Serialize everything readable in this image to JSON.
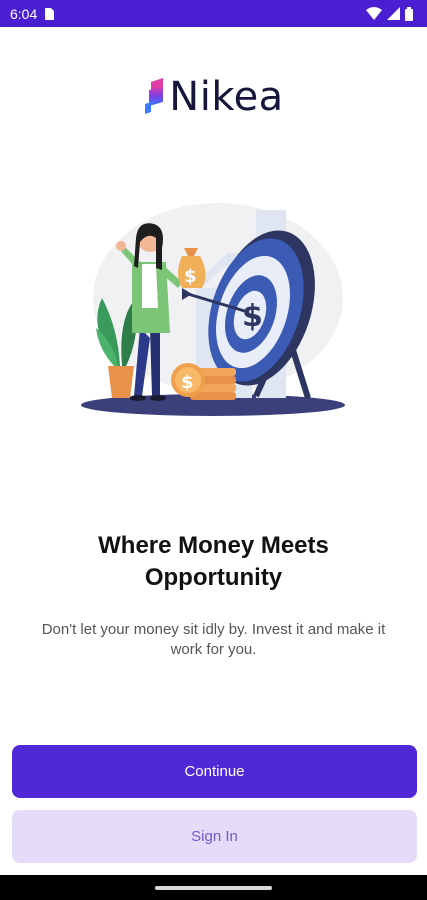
{
  "status_bar": {
    "time": "6:04"
  },
  "brand": {
    "name": "Nikea",
    "accent": "#5128d8"
  },
  "onboarding": {
    "headline_line1": "Where Money Meets",
    "headline_line2": "Opportunity",
    "description": "Don't let your money sit idly by. Invest it and make it work for you.",
    "illustration_icon": "investment-target-illustration"
  },
  "actions": {
    "continue_label": "Continue",
    "sign_in_label": "Sign In"
  },
  "colors": {
    "status_bar": "#4a1fd1",
    "primary_button": "#5128d8",
    "secondary_button": "#e4dcf8",
    "secondary_text": "#6d5bd0"
  }
}
